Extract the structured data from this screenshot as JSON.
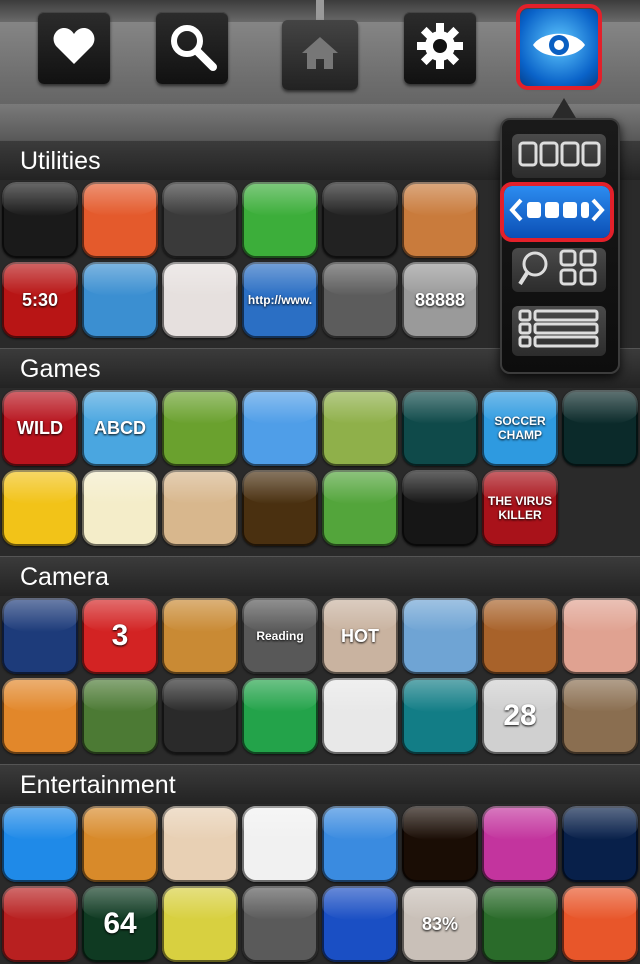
{
  "toolbar": {
    "buttons": [
      {
        "icon": "heart-icon"
      },
      {
        "icon": "search-icon"
      },
      {
        "icon": "home-icon"
      },
      {
        "icon": "gear-icon"
      },
      {
        "icon": "eye-icon",
        "active": true
      }
    ],
    "accent_color": "#e3202a"
  },
  "view_menu": {
    "options": [
      {
        "icon": "four-squares-row-icon"
      },
      {
        "icon": "scroll-row-icon",
        "selected": true
      },
      {
        "icon": "search-grid-icon"
      },
      {
        "icon": "list-view-icon"
      }
    ]
  },
  "sections": [
    {
      "title": "Utilities",
      "rows": [
        [
          {
            "name": "flashlight-app",
            "color": "#1a1a1a"
          },
          {
            "name": "checklist-app",
            "color": "#e45a2c"
          },
          {
            "name": "shield-app",
            "color": "#3a3a3a"
          },
          {
            "name": "sync-app",
            "color": "#3cae3a"
          },
          {
            "name": "voice-recorder-app",
            "color": "#222222"
          },
          {
            "name": "tip-calculator-app",
            "color": "#c97b3c"
          }
        ],
        [
          {
            "name": "alarm-clock-app",
            "color": "#b81515",
            "text": "5:30"
          },
          {
            "name": "zip-app",
            "color": "#3b8fd1"
          },
          {
            "name": "lips-app",
            "color": "#e6e0de"
          },
          {
            "name": "browser-app",
            "color": "#2b6fc4",
            "text": "http://www."
          },
          {
            "name": "microphone-app",
            "color": "#5c5c5c"
          },
          {
            "name": "calculator-app",
            "color": "#9a9a9a",
            "text": "88888"
          }
        ]
      ]
    },
    {
      "title": "Games",
      "rows": [
        [
          {
            "name": "wild-app",
            "color": "#b8141e",
            "text": "WILD"
          },
          {
            "name": "abc-app",
            "color": "#4aa6e0",
            "text": "ABCD"
          },
          {
            "name": "jungle-app",
            "color": "#6aa12e"
          },
          {
            "name": "bubbles-app",
            "color": "#4f9ee8"
          },
          {
            "name": "explosion-app",
            "color": "#8fb04a"
          },
          {
            "name": "sparkle-app",
            "color": "#0f4a4a"
          },
          {
            "name": "soccer-champ-app",
            "color": "#2e9ae0",
            "text": "SOCCER CHAMP"
          },
          {
            "name": "radar-app",
            "color": "#0b2a2a"
          }
        ],
        [
          {
            "name": "robber-app",
            "color": "#f2c318"
          },
          {
            "name": "balloons-app",
            "color": "#f4edc9"
          },
          {
            "name": "finger-slice-app",
            "color": "#d8b78d"
          },
          {
            "name": "cannon-app",
            "color": "#4a3010"
          },
          {
            "name": "virus-app",
            "color": "#53a53b"
          },
          {
            "name": "neon-u-app",
            "color": "#161616"
          },
          {
            "name": "virus-killer-app",
            "color": "#a9121a",
            "text": "THE VIRUS KILLER"
          }
        ]
      ]
    },
    {
      "title": "Camera",
      "rows": [
        [
          {
            "name": "video-app",
            "color": "#1d3b7a"
          },
          {
            "name": "countdown-app",
            "color": "#d32323",
            "text": "3"
          },
          {
            "name": "photo-crop-app",
            "color": "#c98a34"
          },
          {
            "name": "reading-app",
            "color": "#585858",
            "text": "Reading"
          },
          {
            "name": "cute-photo-app",
            "color": "#c9b3a0",
            "text": "HOT"
          },
          {
            "name": "gallery-app",
            "color": "#6fa4d4"
          },
          {
            "name": "rotate-photo-app",
            "color": "#a8622a"
          },
          {
            "name": "kiss-app",
            "color": "#e0a291"
          }
        ],
        [
          {
            "name": "funny-face-app",
            "color": "#e2872a"
          },
          {
            "name": "binoculars-app",
            "color": "#4c7a34"
          },
          {
            "name": "keyhole-app",
            "color": "#2a2a2a"
          },
          {
            "name": "green-man-app",
            "color": "#23a34a"
          },
          {
            "name": "eye-color-app",
            "color": "#e8e8e8"
          },
          {
            "name": "ruler-app",
            "color": "#127d86"
          },
          {
            "name": "calendar-camera-app",
            "color": "#d0d0d0",
            "text": "28"
          },
          {
            "name": "fisherman-app",
            "color": "#8a6e50"
          }
        ]
      ]
    },
    {
      "title": "Entertainment",
      "rows": [
        [
          {
            "name": "blue-monster-app",
            "color": "#1f8ae8"
          },
          {
            "name": "light-man-app",
            "color": "#d88a2a"
          },
          {
            "name": "phone-pig-app",
            "color": "#e8d0b4"
          },
          {
            "name": "warning-app",
            "color": "#f1f1f1"
          },
          {
            "name": "moon-sleep-app",
            "color": "#3a8be0"
          },
          {
            "name": "candle-app",
            "color": "#1a0d05"
          },
          {
            "name": "birthday-cake-app",
            "color": "#c3349e"
          },
          {
            "name": "blue-orb-app",
            "color": "#08204a"
          }
        ],
        [
          {
            "name": "star-flower-app",
            "color": "#b82020"
          },
          {
            "name": "heart-rate-app",
            "color": "#0f3a22",
            "text": "64"
          },
          {
            "name": "message-app",
            "color": "#d8d040"
          },
          {
            "name": "game-controller-app",
            "color": "#5a5a5a"
          },
          {
            "name": "blue-portal-app",
            "color": "#1a4fc4"
          },
          {
            "name": "love-meter-app",
            "color": "#c9c0b8",
            "text": "83%"
          },
          {
            "name": "target-phone-app",
            "color": "#2a6b2a"
          },
          {
            "name": "power-app",
            "color": "#e8562a"
          }
        ]
      ]
    }
  ]
}
